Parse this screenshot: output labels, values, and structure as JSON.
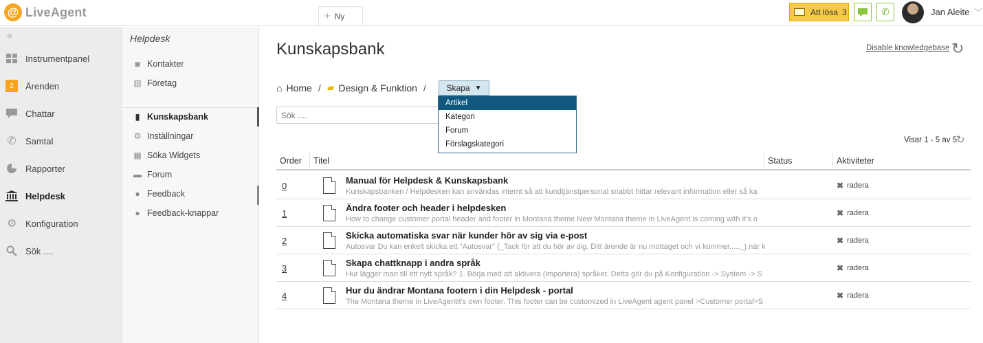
{
  "app": {
    "logo_letter": "@",
    "logo_text": "LiveAgent"
  },
  "topbar": {
    "new_tab_label": "Ny",
    "att_losa_label": "Att lösa",
    "att_losa_count": "3",
    "user_name": "Jan Aleite"
  },
  "leftnav": {
    "items": [
      {
        "label": "Instrumentpanel",
        "icon": "dashboard-icon"
      },
      {
        "label": "Ärenden",
        "icon": "tickets-badge-icon",
        "badge": "2"
      },
      {
        "label": "Chattar",
        "icon": "chat-icon"
      },
      {
        "label": "Samtal",
        "icon": "phone-icon"
      },
      {
        "label": "Rapporter",
        "icon": "pie-chart-icon"
      },
      {
        "label": "Helpdesk",
        "icon": "bank-icon",
        "active": true
      },
      {
        "label": "Konfiguration",
        "icon": "gear-icon"
      },
      {
        "label": "Sök ....",
        "icon": "search-icon"
      }
    ]
  },
  "subnav": {
    "title": "Helpdesk",
    "items": [
      {
        "label": "Kontakter",
        "icon": "contact-icon"
      },
      {
        "label": "Företag",
        "icon": "building-icon"
      },
      {
        "label": "Kunskapsbank",
        "icon": "book-icon",
        "active": true
      },
      {
        "label": "Inställningar",
        "icon": "gear-icon"
      },
      {
        "label": "Söka Widgets",
        "icon": "widget-icon"
      },
      {
        "label": "Forum",
        "icon": "forum-icon"
      },
      {
        "label": "Feedback",
        "icon": "feedback-icon"
      },
      {
        "label": "Feedback-knappar",
        "icon": "feedback-button-icon"
      }
    ]
  },
  "main": {
    "title": "Kunskapsbank",
    "disable_link": "Disable knowledgebase",
    "breadcrumb": {
      "home": "Home",
      "folder": "Design & Funktion",
      "separator": "/"
    },
    "skapa_label": "Skapa",
    "dropdown": [
      "Artikel",
      "Kategori",
      "Forum",
      "Förslagskategori"
    ],
    "search_placeholder": "Sök ....",
    "visar": "Visar 1 - 5 av 5",
    "columns": {
      "order": "Order",
      "title": "Titel",
      "status": "Status",
      "activities": "Aktiviteter"
    },
    "rows": [
      {
        "order": "0",
        "title": "Manual för Helpdesk & Kunskapsbank",
        "desc": "Kunskapsbanken / Helpdesken kan användas internt så att kundtjänstpersonal snabbt hittar relevant information eller så ka",
        "action": "radera"
      },
      {
        "order": "1",
        "title": "Ändra footer och header i helpdesken",
        "desc": "How to change customer portal header and footer in Montana theme New Montana theme in LiveAgent is coming with it's o",
        "action": "radera"
      },
      {
        "order": "2",
        "title": "Skicka automatiska svar när kunder hör av sig via e-post",
        "desc": "Autosvar Du kan enkelt skicka ett \"Autosvar\" (_Tack för att du hör av dig. Ditt ärende är nu mottaget och vi kommer....._) när k",
        "action": "radera"
      },
      {
        "order": "3",
        "title": "Skapa chattknapp i andra språk",
        "desc": "Hur lägger man till ett nytt språk? 1. Börja med att aktivera (importera) språket. Detta gör du på Konfiguration -> System -> S",
        "action": "radera"
      },
      {
        "order": "4",
        "title": "Hur du ändrar Montana footern i din Helpdesk - portal",
        "desc": "The Montana theme in LiveAgentit's own footer. This footer can be customized in LiveAgent agent panel >Customer portal>S",
        "action": "radera"
      }
    ]
  },
  "colors": {
    "accent": "#f7c948",
    "dropdown_selected": "#10587e",
    "skapa_bg": "#d6e6ef",
    "badge": "#f7a51c"
  }
}
